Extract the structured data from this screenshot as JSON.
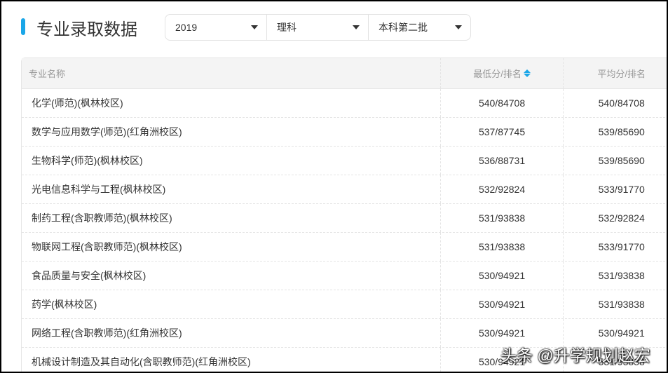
{
  "title": "专业录取数据",
  "filters": {
    "year": "2019",
    "subject": "理科",
    "batch": "本科第二批"
  },
  "columns": [
    "专业名称",
    "最低分/排名",
    "平均分/排名"
  ],
  "rows": [
    [
      "化学(师范)(枫林校区)",
      "540/84708",
      "540/84708"
    ],
    [
      "数学与应用数学(师范)(红角洲校区)",
      "537/87745",
      "539/85690"
    ],
    [
      "生物科学(师范)(枫林校区)",
      "536/88731",
      "539/85690"
    ],
    [
      "光电信息科学与工程(枫林校区)",
      "532/92824",
      "533/91770"
    ],
    [
      "制药工程(含职教师范)(枫林校区)",
      "531/93838",
      "532/92824"
    ],
    [
      "物联网工程(含职教师范)(枫林校区)",
      "531/93838",
      "533/91770"
    ],
    [
      "食品质量与安全(枫林校区)",
      "530/94921",
      "531/93838"
    ],
    [
      "药学(枫林校区)",
      "530/94921",
      "531/93838"
    ],
    [
      "网络工程(含职教师范)(红角洲校区)",
      "530/94921",
      "530/94921"
    ],
    [
      "机械设计制造及其自动化(含职教师范)(红角洲校区)",
      "530/94921",
      "531/93838"
    ]
  ],
  "watermark": "头条 @升学规划赵宏"
}
